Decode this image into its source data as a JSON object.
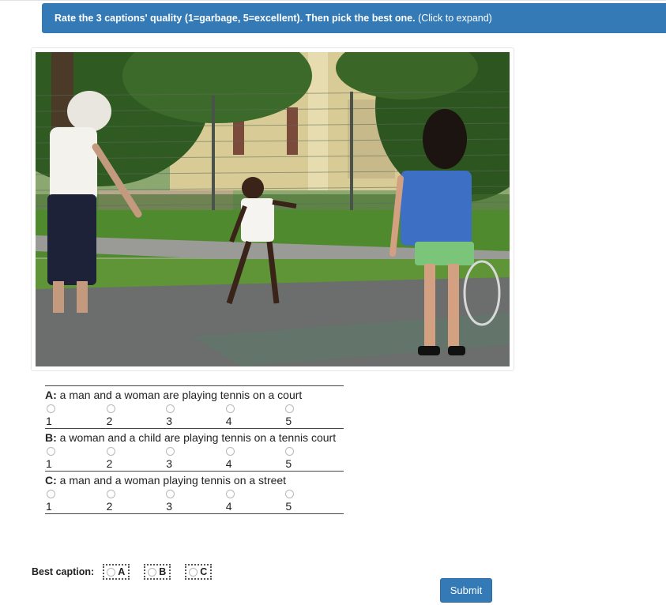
{
  "header": {
    "instruction_bold": "Rate the 3 captions' quality (1=garbage, 5=excellent). Then pick the best one.",
    "instruction_hint": "(Click to expand)"
  },
  "image": {
    "description_icon": "photo"
  },
  "captions": [
    {
      "letter": "A:",
      "text": "a man and a woman are playing tennis on a court"
    },
    {
      "letter": "B:",
      "text": "a woman and a child are playing tennis on a tennis court"
    },
    {
      "letter": "C:",
      "text": "a man and a woman playing tennis on a street"
    }
  ],
  "scale": [
    "1",
    "2",
    "3",
    "4",
    "5"
  ],
  "best": {
    "label": "Best caption:",
    "options": [
      "A",
      "B",
      "C"
    ]
  },
  "submit_label": "Submit",
  "colors": {
    "accent": "#337ab7"
  }
}
